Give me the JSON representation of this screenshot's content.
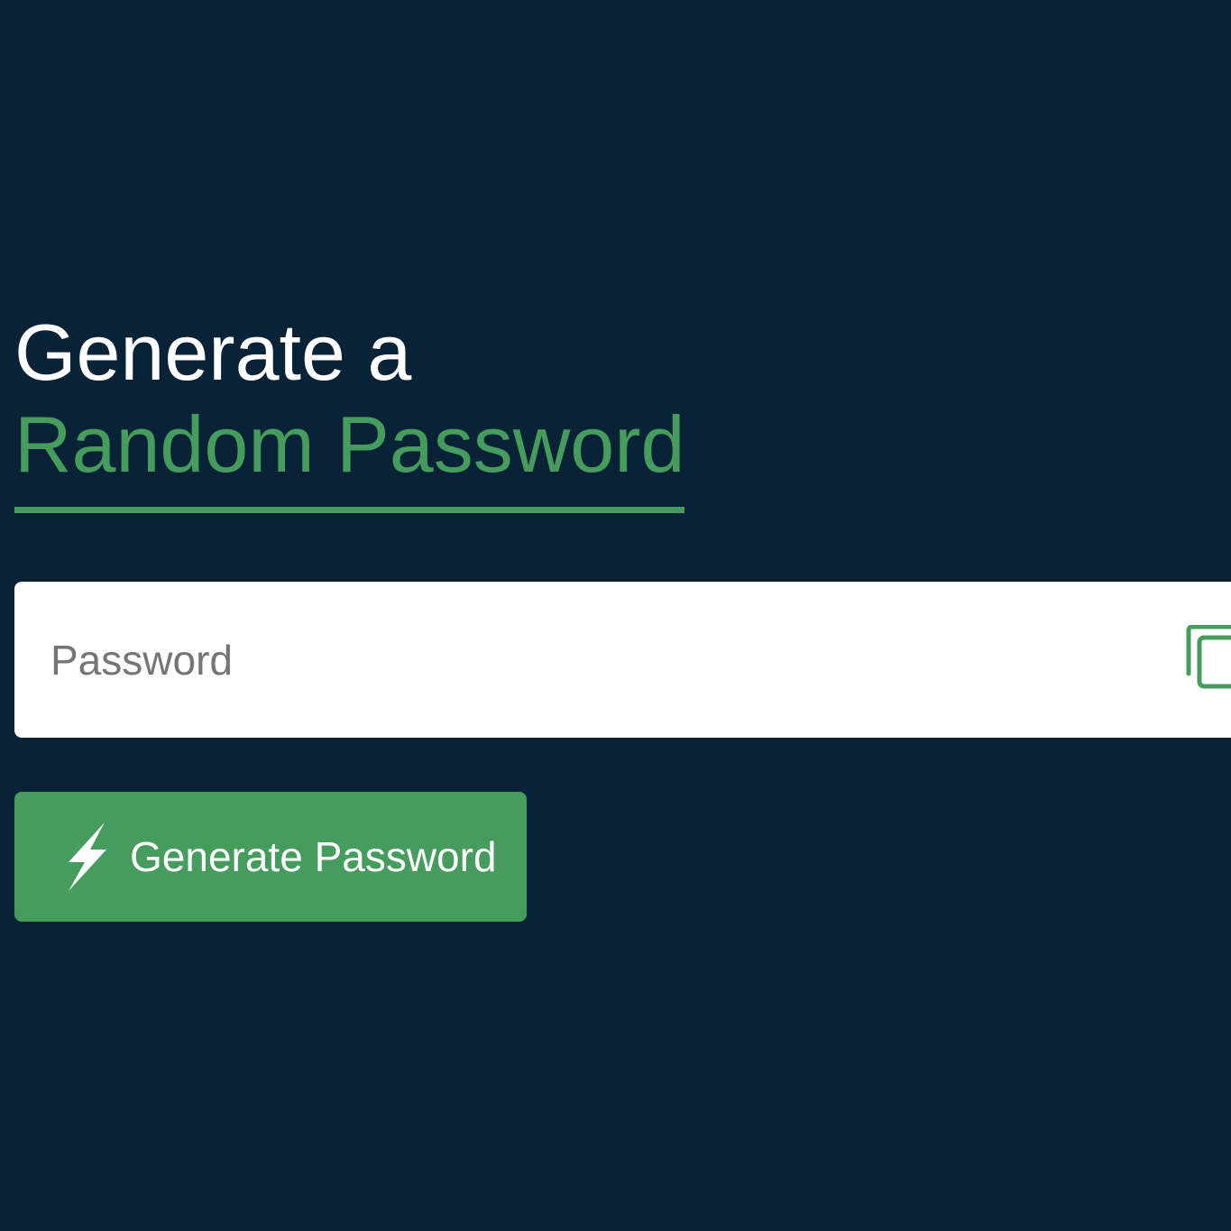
{
  "heading": {
    "line1": "Generate a",
    "line2": "Random Password"
  },
  "password": {
    "placeholder": "Password",
    "value": ""
  },
  "actions": {
    "copy_icon": "copy-icon",
    "generate_label": "Generate Password",
    "generate_icon": "lightning-bolt-icon"
  },
  "colors": {
    "background": "#0a2236",
    "accent": "#469c5d",
    "heading_text": "#ffffff",
    "placeholder_text": "#757575"
  }
}
